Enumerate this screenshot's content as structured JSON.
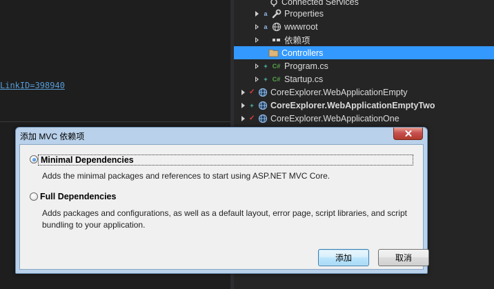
{
  "editor": {
    "link_text": "LinkID=398940"
  },
  "explorer": {
    "items": [
      {
        "label": "Connected Services",
        "icon": "connected-services-icon"
      },
      {
        "label": "Properties",
        "icon": "wrench-icon"
      },
      {
        "label": "wwwroot",
        "icon": "globe-icon"
      },
      {
        "label": "依赖项",
        "icon": "dependencies-icon"
      },
      {
        "label": "Controllers",
        "icon": "folder-icon"
      },
      {
        "label": "Program.cs",
        "icon": "csharp-file-icon",
        "badge": "+"
      },
      {
        "label": "Startup.cs",
        "icon": "csharp-file-icon",
        "badge": "+"
      },
      {
        "label": "CoreExplorer.WebApplicationEmpty",
        "icon": "web-project-icon"
      },
      {
        "label": "CoreExplorer.WebApplicationEmptyTwo",
        "icon": "web-project-icon",
        "badge": "+"
      },
      {
        "label": "CoreExplorer.WebApplicationOne",
        "icon": "web-project-icon"
      }
    ],
    "csharp_glyph": "C#"
  },
  "dialog": {
    "title": "添加 MVC 依赖项",
    "options": [
      {
        "label": "Minimal Dependencies",
        "description": "Adds the minimal packages and references to start using ASP.NET MVC Core.",
        "checked": true
      },
      {
        "label": "Full Dependencies",
        "description": "Adds packages and configurations, as well as a default layout, error page, script libraries, and script bundling to your application.",
        "checked": false
      }
    ],
    "ok_label": "添加",
    "cancel_label": "取消"
  },
  "colors": {
    "selection": "#3399ff",
    "dialog_frame": "#b9d1ea",
    "close_button": "#c75050"
  }
}
